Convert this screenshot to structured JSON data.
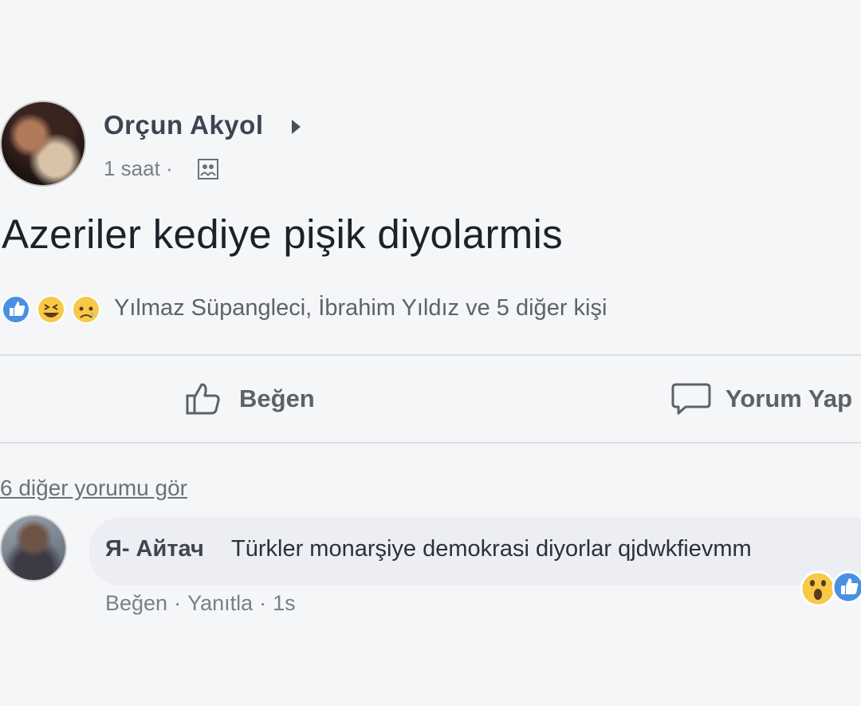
{
  "post": {
    "author": "Orçun Akyol",
    "time": "1 saat",
    "separator": "·",
    "text": "Azeriler kediye pişik diyolarmis",
    "reactions": {
      "icons": [
        "like-reaction-icon",
        "haha-reaction-icon",
        "sad-reaction-icon"
      ],
      "text": "Yılmaz Süpangleci, İbrahim Yıldız ve 5 diğer kişi"
    },
    "actions": {
      "like_label": "Beğen",
      "comment_label": "Yorum Yap"
    }
  },
  "comments": {
    "more_link": "6 diğer yorumu gör",
    "items": [
      {
        "author": "Я- Айтач",
        "text": "Türkler monarşiye demokrasi diyorlar qjdwkfievmm",
        "like": "Beğen",
        "reply": "Yanıtla",
        "time": "1s",
        "reaction_icons": [
          "wow-reaction-icon",
          "like-reaction-icon"
        ]
      }
    ]
  },
  "colors": {
    "background": "#f5f6f8",
    "like_blue": "#4a90e2",
    "reaction_yellow": "#f7c948",
    "text_gray": "#5d626b"
  }
}
